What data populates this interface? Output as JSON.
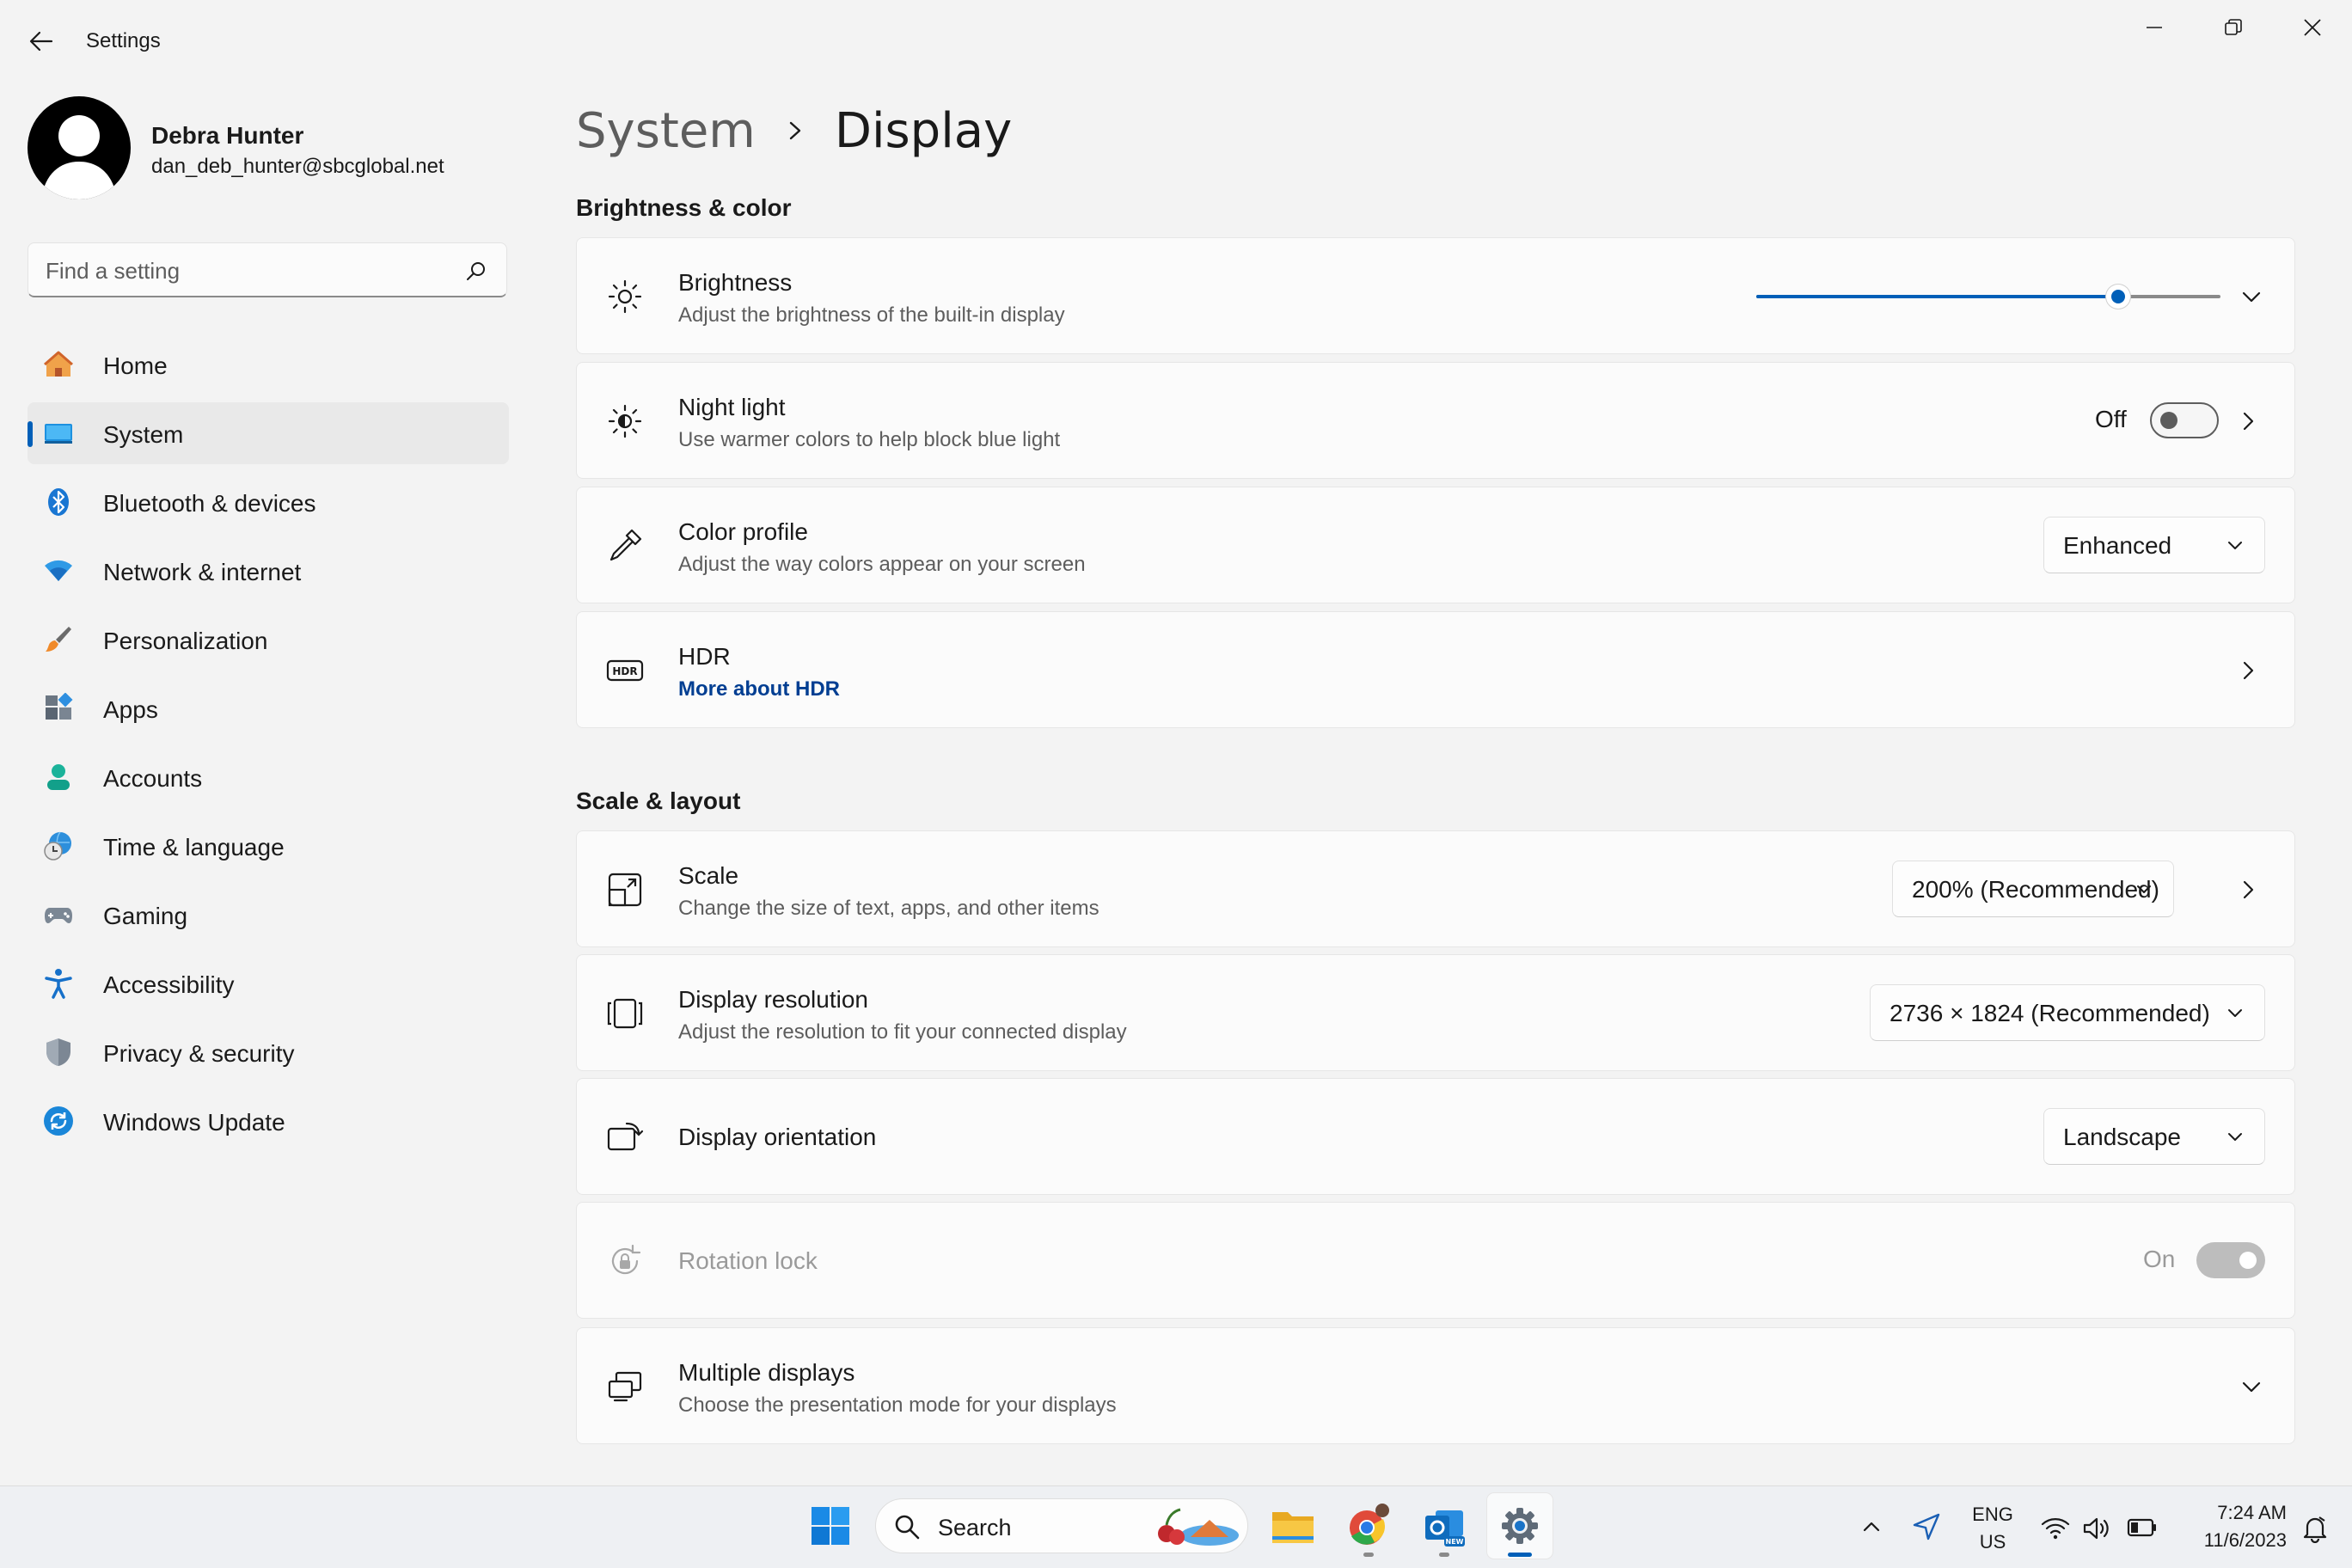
{
  "window": {
    "title": "Settings"
  },
  "user": {
    "name": "Debra Hunter",
    "email": "dan_deb_hunter@sbcglobal.net"
  },
  "search": {
    "placeholder": "Find a setting"
  },
  "nav": {
    "items": [
      {
        "label": "Home",
        "icon": "home-icon"
      },
      {
        "label": "System",
        "icon": "system-icon",
        "selected": true
      },
      {
        "label": "Bluetooth & devices",
        "icon": "bluetooth-icon"
      },
      {
        "label": "Network & internet",
        "icon": "wifi-icon"
      },
      {
        "label": "Personalization",
        "icon": "brush-icon"
      },
      {
        "label": "Apps",
        "icon": "apps-icon"
      },
      {
        "label": "Accounts",
        "icon": "accounts-icon"
      },
      {
        "label": "Time & language",
        "icon": "globe-clock-icon"
      },
      {
        "label": "Gaming",
        "icon": "gamepad-icon"
      },
      {
        "label": "Accessibility",
        "icon": "accessibility-icon"
      },
      {
        "label": "Privacy & security",
        "icon": "shield-icon"
      },
      {
        "label": "Windows Update",
        "icon": "update-icon"
      }
    ]
  },
  "breadcrumb": {
    "parent": "System",
    "current": "Display"
  },
  "brightness_color": {
    "title": "Brightness & color",
    "brightness": {
      "title": "Brightness",
      "subtitle": "Adjust the brightness of the built-in display",
      "level": 0.78
    },
    "night_light": {
      "title": "Night light",
      "subtitle": "Use warmer colors to help block blue light",
      "state": "Off"
    },
    "color_profile": {
      "title": "Color profile",
      "subtitle": "Adjust the way colors appear on your screen",
      "value": "Enhanced"
    },
    "hdr": {
      "title": "HDR",
      "link": "More about HDR"
    }
  },
  "scale_layout": {
    "title": "Scale & layout",
    "scale": {
      "title": "Scale",
      "subtitle": "Change the size of text, apps, and other items",
      "value": "200% (Recommended)"
    },
    "resolution": {
      "title": "Display resolution",
      "subtitle": "Adjust the resolution to fit your connected display",
      "value": "2736 × 1824 (Recommended)"
    },
    "orientation": {
      "title": "Display orientation",
      "value": "Landscape"
    },
    "rotation_lock": {
      "title": "Rotation lock",
      "state": "On",
      "disabled": true
    },
    "multiple_displays": {
      "title": "Multiple displays",
      "subtitle": "Choose the presentation mode for your displays"
    }
  },
  "taskbar": {
    "search_label": "Search",
    "lang_top": "ENG",
    "lang_bottom": "US",
    "time": "7:24 AM",
    "date": "11/6/2023"
  },
  "colors": {
    "accent": "#005fb8",
    "link": "#003e92",
    "background": "#f3f3f3",
    "card": "#fbfbfb"
  }
}
